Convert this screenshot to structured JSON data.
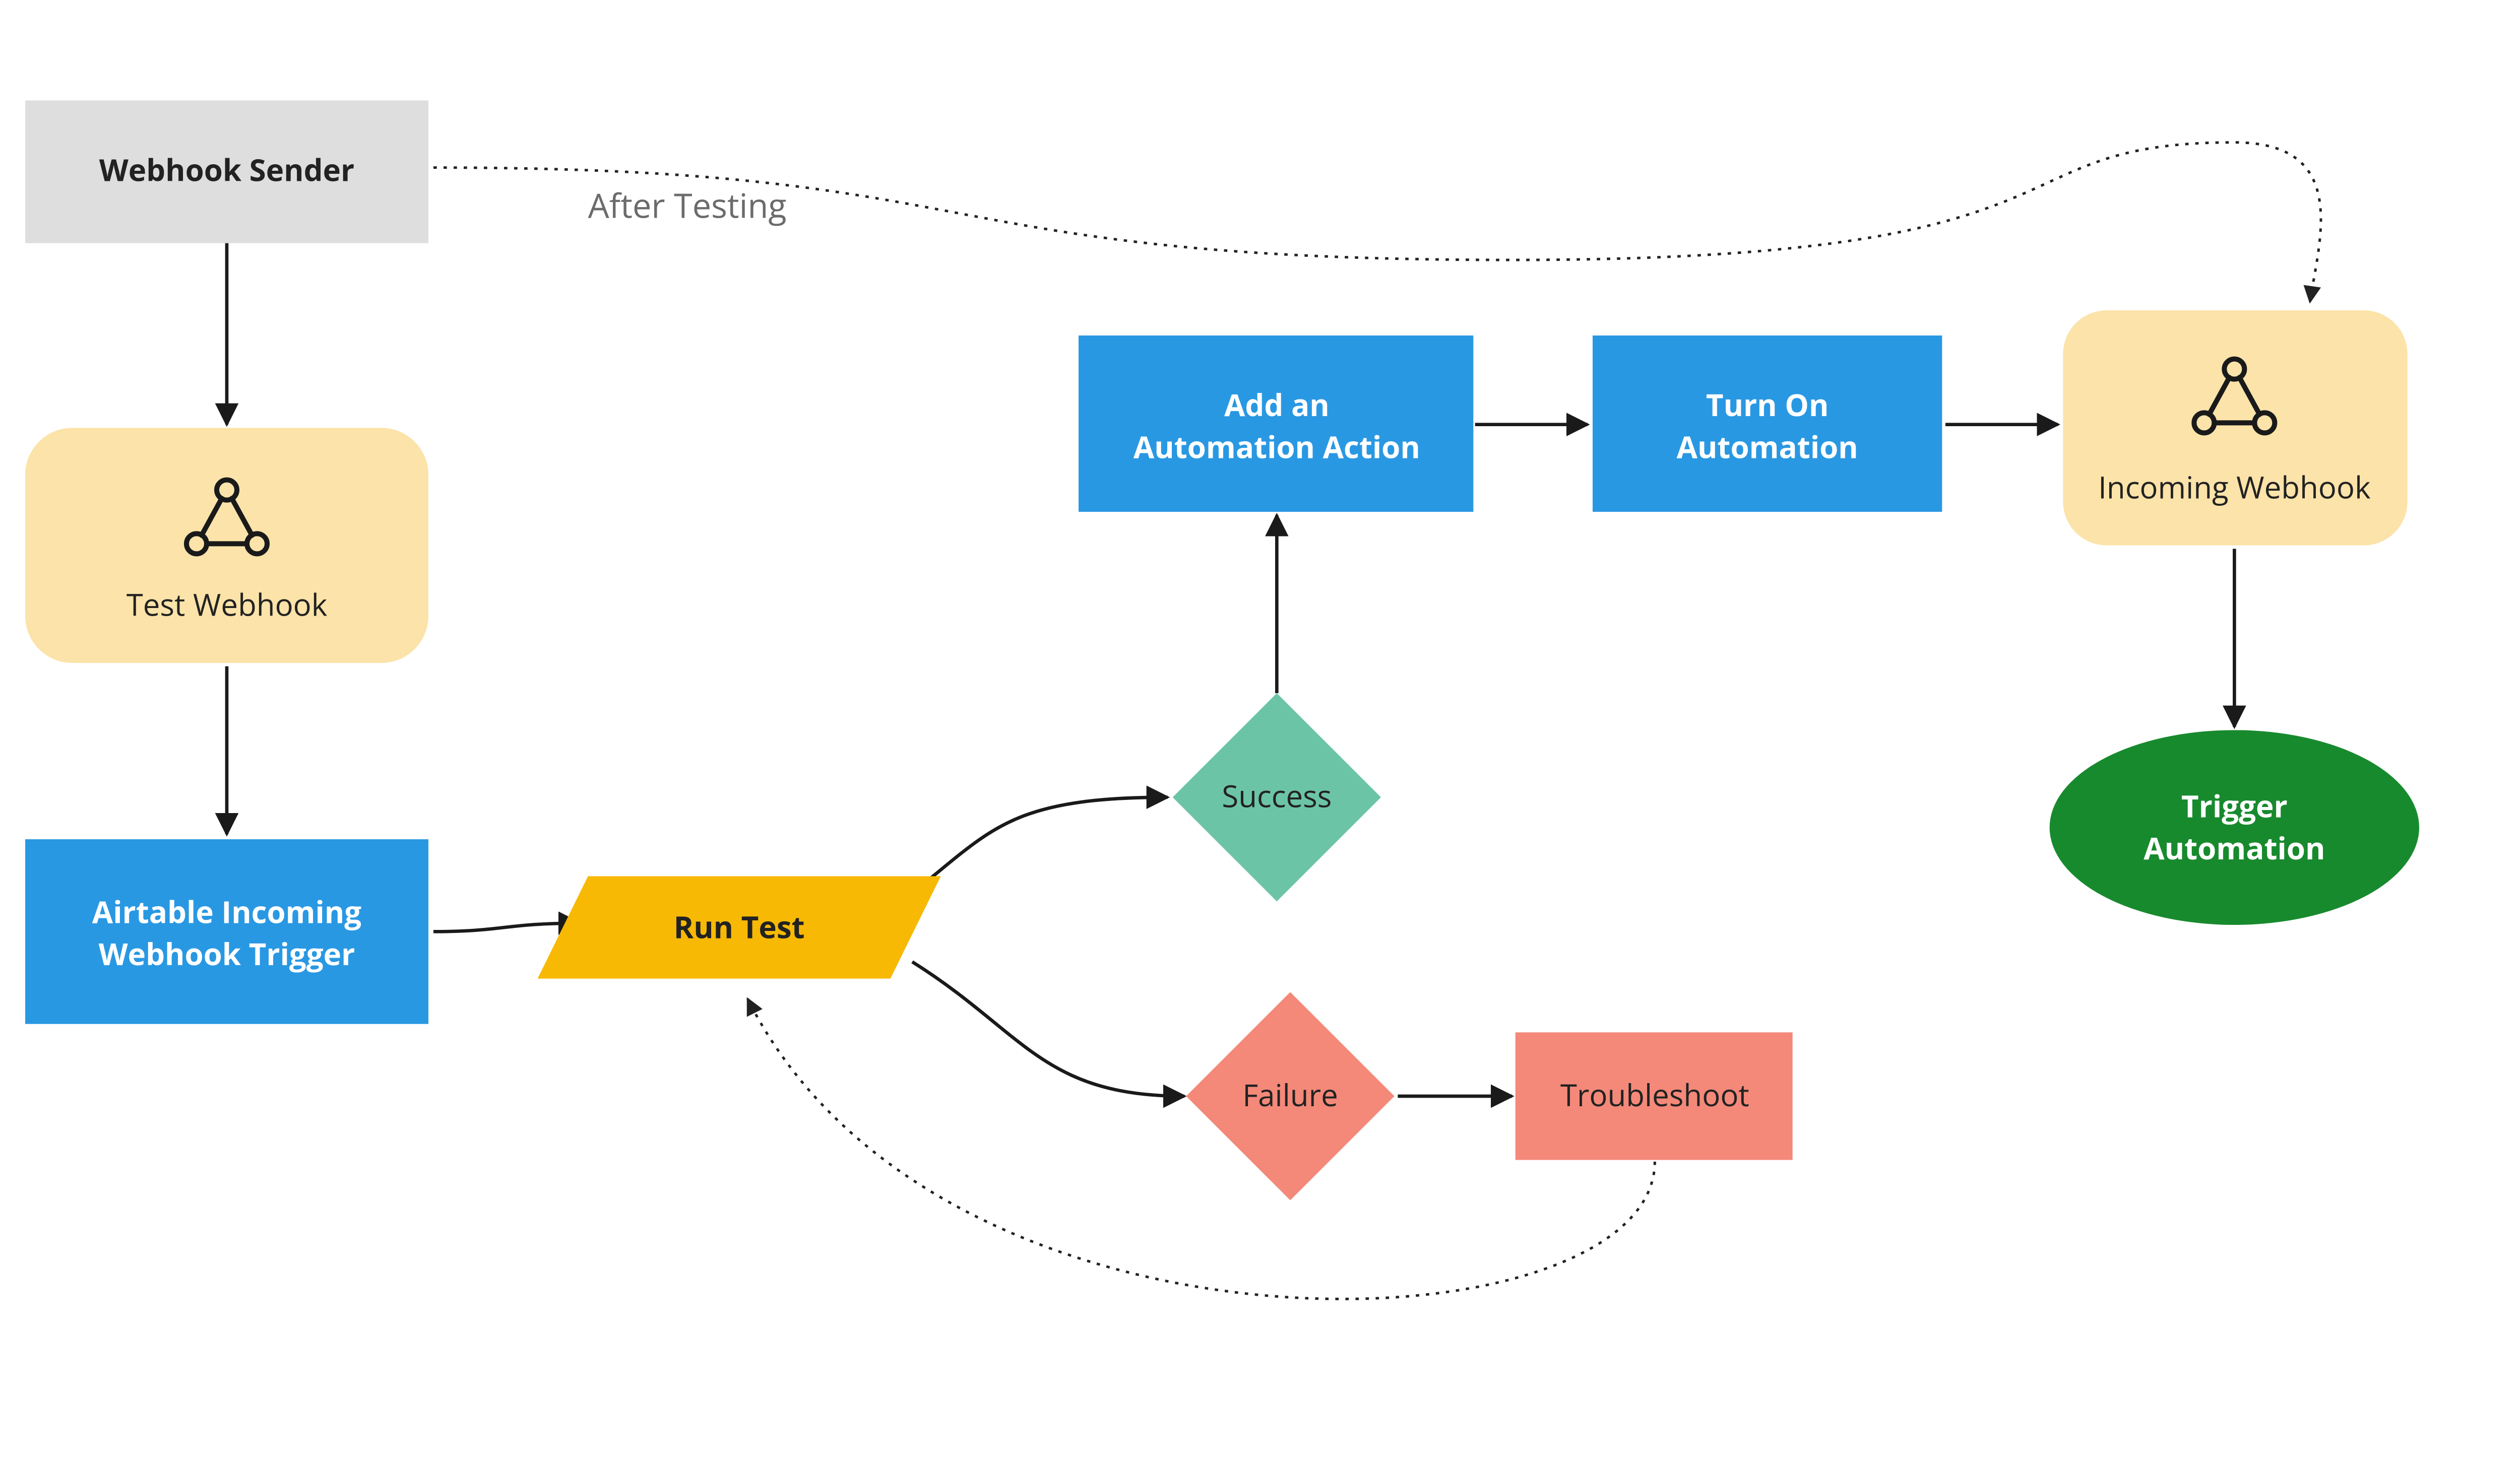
{
  "nodes": {
    "webhook_sender": {
      "label": "Webhook Sender"
    },
    "test_webhook": {
      "label": "Test Webhook"
    },
    "airtable_trigger": {
      "line1": "Airtable Incoming",
      "line2": "Webhook Trigger"
    },
    "run_test": {
      "label": "Run Test"
    },
    "success": {
      "label": "Success"
    },
    "failure": {
      "label": "Failure"
    },
    "troubleshoot": {
      "label": "Troubleshoot"
    },
    "add_action": {
      "line1": "Add an",
      "line2": "Automation Action"
    },
    "turn_on": {
      "line1": "Turn On",
      "line2": "Automation"
    },
    "incoming_webhook": {
      "label": "Incoming Webhook"
    },
    "trigger_automation": {
      "line1": "Trigger",
      "line2": "Automation"
    }
  },
  "edges": {
    "after_testing": {
      "label": "After Testing"
    }
  },
  "colors": {
    "gray": "#dedede",
    "cream": "#fbe3a9",
    "blue": "#2998e3",
    "amber": "#f7b904",
    "teal": "#6cc4a6",
    "salmon": "#f48979",
    "green": "#188a2e",
    "stroke": "#1a1a1a",
    "dotted": "#222222"
  },
  "chart_data": {
    "type": "flowchart",
    "nodes": [
      {
        "id": "webhook_sender",
        "label": "Webhook Sender",
        "shape": "rect",
        "color": "gray"
      },
      {
        "id": "test_webhook",
        "label": "Test Webhook",
        "shape": "rounded-rect",
        "color": "cream",
        "icon": "webhook"
      },
      {
        "id": "airtable_trigger",
        "label": "Airtable Incoming Webhook Trigger",
        "shape": "rect",
        "color": "blue"
      },
      {
        "id": "run_test",
        "label": "Run Test",
        "shape": "parallelogram",
        "color": "amber"
      },
      {
        "id": "success",
        "label": "Success",
        "shape": "diamond",
        "color": "teal"
      },
      {
        "id": "failure",
        "label": "Failure",
        "shape": "diamond",
        "color": "salmon"
      },
      {
        "id": "troubleshoot",
        "label": "Troubleshoot",
        "shape": "rect",
        "color": "salmon"
      },
      {
        "id": "add_action",
        "label": "Add an Automation Action",
        "shape": "rect",
        "color": "blue"
      },
      {
        "id": "turn_on",
        "label": "Turn On Automation",
        "shape": "rect",
        "color": "blue"
      },
      {
        "id": "incoming_webhook",
        "label": "Incoming Webhook",
        "shape": "rounded-rect",
        "color": "cream",
        "icon": "webhook"
      },
      {
        "id": "trigger_automation",
        "label": "Trigger Automation",
        "shape": "ellipse",
        "color": "green"
      }
    ],
    "edges": [
      {
        "from": "webhook_sender",
        "to": "test_webhook",
        "style": "solid"
      },
      {
        "from": "test_webhook",
        "to": "airtable_trigger",
        "style": "solid"
      },
      {
        "from": "airtable_trigger",
        "to": "run_test",
        "style": "solid"
      },
      {
        "from": "run_test",
        "to": "success",
        "style": "solid"
      },
      {
        "from": "run_test",
        "to": "failure",
        "style": "solid"
      },
      {
        "from": "failure",
        "to": "troubleshoot",
        "style": "solid"
      },
      {
        "from": "troubleshoot",
        "to": "run_test",
        "style": "dotted"
      },
      {
        "from": "success",
        "to": "add_action",
        "style": "solid"
      },
      {
        "from": "add_action",
        "to": "turn_on",
        "style": "solid"
      },
      {
        "from": "turn_on",
        "to": "incoming_webhook",
        "style": "solid"
      },
      {
        "from": "incoming_webhook",
        "to": "trigger_automation",
        "style": "solid"
      },
      {
        "from": "webhook_sender",
        "to": "incoming_webhook",
        "style": "dotted",
        "label": "After Testing"
      }
    ]
  }
}
